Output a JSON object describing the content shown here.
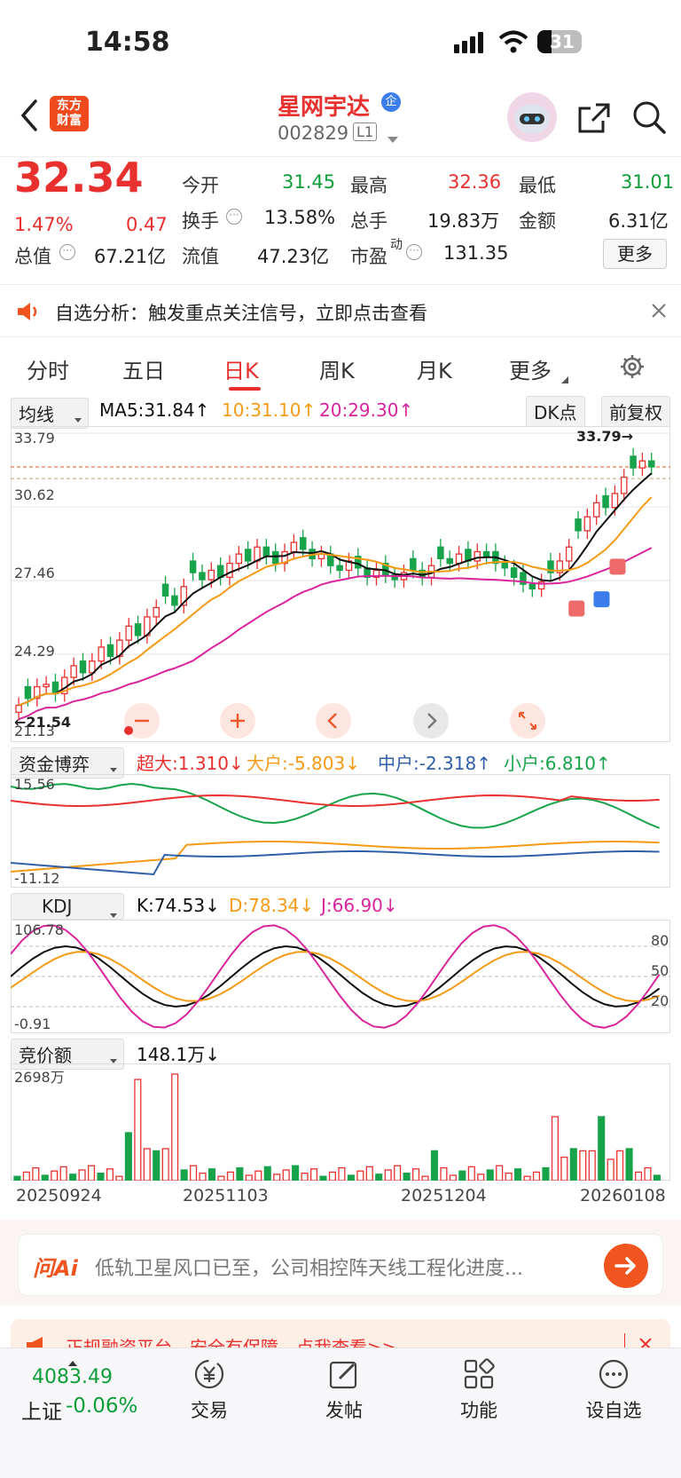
{
  "status": {
    "time": "14:58",
    "battery": "31"
  },
  "header": {
    "stock_name": "星网宇达",
    "stock_code": "002829",
    "badge": "L1",
    "ent_tag": "企",
    "logo_line1": "东方",
    "logo_line2": "财富"
  },
  "quote": {
    "price": "32.34",
    "change_pct": "1.47%",
    "change": "0.47",
    "open_label": "今开",
    "open": "31.45",
    "high_label": "最高",
    "high": "32.36",
    "low_label": "最低",
    "low": "31.01",
    "turnover_label": "换手",
    "turnover": "13.58%",
    "volume_label": "总手",
    "volume": "19.83万",
    "amount_label": "金额",
    "amount": "6.31亿",
    "mcap_label": "总值",
    "mcap": "67.21亿",
    "float_label": "流值",
    "float": "47.23亿",
    "pe_label": "市盈",
    "pe_sup": "动",
    "pe": "131.35",
    "more": "更多"
  },
  "notice": {
    "text": "自选分析：触发重点关注信号，立即点击查看"
  },
  "tabs": [
    "分时",
    "五日",
    "日K",
    "周K",
    "月K",
    "更多"
  ],
  "indicators": {
    "ma_select": "均线",
    "ma5": "MA5:31.84↑",
    "ma10": "10:31.10↑",
    "ma20": "20:29.30↑",
    "dk": "DK点",
    "fq": "前复权",
    "flow_select": "资金博弈",
    "super": "超大:1.310↓",
    "big": "大户:-5.803↓",
    "mid": "中户:-2.318↑",
    "small": "小户:6.810↑",
    "kdj_select": "KDJ",
    "k": "K:74.53↓",
    "d": "D:78.34↓",
    "j": "J:66.90↓",
    "bid_select": "竞价额",
    "bid_val": "148.1万↓"
  },
  "chart_data": {
    "type": "candlestick",
    "price_axis": {
      "ticks": [
        "33.79",
        "30.62",
        "27.46",
        "24.29",
        "21.13"
      ],
      "max_label": "33.79→",
      "min_label": "←21.54"
    },
    "dates": [
      "20250924",
      "20251103",
      "20251204",
      "20260108"
    ],
    "flow_axis": {
      "ticks": [
        "15.56",
        "-11.12"
      ]
    },
    "kdj_axis": {
      "ticks": [
        "106.78",
        "-0.91"
      ],
      "levels": [
        "80",
        "50",
        "20"
      ]
    },
    "bid_axis": {
      "ticks": [
        "2698万"
      ]
    },
    "colors": {
      "up": "#e8312f",
      "down": "#17a34a",
      "ma5": "#111111",
      "ma10": "#f59a14",
      "ma20": "#d9259b"
    }
  },
  "ask": {
    "brand": "问Ai",
    "text": "低轨卫星风口已至，公司相控阵天线工程化进度..."
  },
  "promo": {
    "text": "正规融资平台，安全有保障，点我查看>>"
  },
  "bottom": {
    "index_value": "4083.49",
    "index_name": "上证",
    "index_change": "-0.06%",
    "nav": [
      "交易",
      "发帖",
      "功能",
      "设自选"
    ]
  }
}
